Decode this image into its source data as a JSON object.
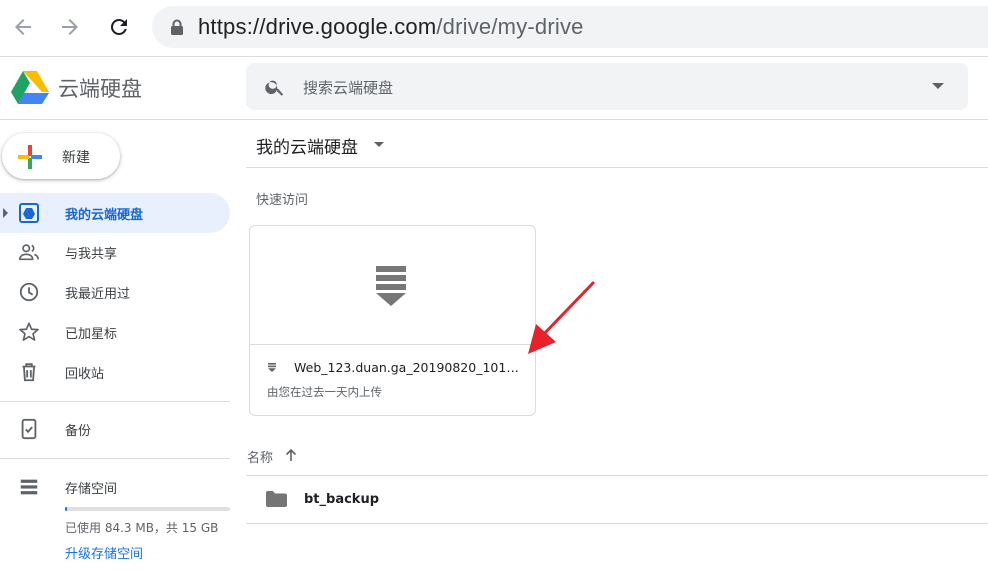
{
  "browser": {
    "url_host": "https://drive.google.com",
    "url_path": "/drive/my-drive"
  },
  "app": {
    "title": "云端硬盘",
    "search_placeholder": "搜索云端硬盘"
  },
  "sidebar": {
    "new_label": "新建",
    "items": [
      {
        "label": "我的云端硬盘",
        "icon": "my-drive-icon"
      },
      {
        "label": "与我共享",
        "icon": "people-icon"
      },
      {
        "label": "我最近用过",
        "icon": "clock-icon"
      },
      {
        "label": "已加星标",
        "icon": "star-icon"
      },
      {
        "label": "回收站",
        "icon": "trash-icon"
      },
      {
        "label": "备份",
        "icon": "phone-backup-icon"
      },
      {
        "label": "存储空间",
        "icon": "storage-icon"
      }
    ],
    "storage": {
      "used_text": "已使用 84.3 MB，共 15 GB",
      "used_fraction": 0.006,
      "upgrade_label": "升级存储空间"
    }
  },
  "main": {
    "title": "我的云端硬盘",
    "quick_access_label": "快速访问",
    "quick_card": {
      "file_name": "Web_123.duan.ga_20190820_10111...",
      "subtitle": "由您在过去一天内上传",
      "icon": "archive-download-icon"
    },
    "list_header": "名称",
    "files": [
      {
        "name": "bt_backup",
        "icon": "folder-icon"
      }
    ]
  },
  "colors": {
    "accent_blue": "#1a73e8",
    "active_bg": "#e8f0fe",
    "annotation_arrow": "#e8222b"
  }
}
